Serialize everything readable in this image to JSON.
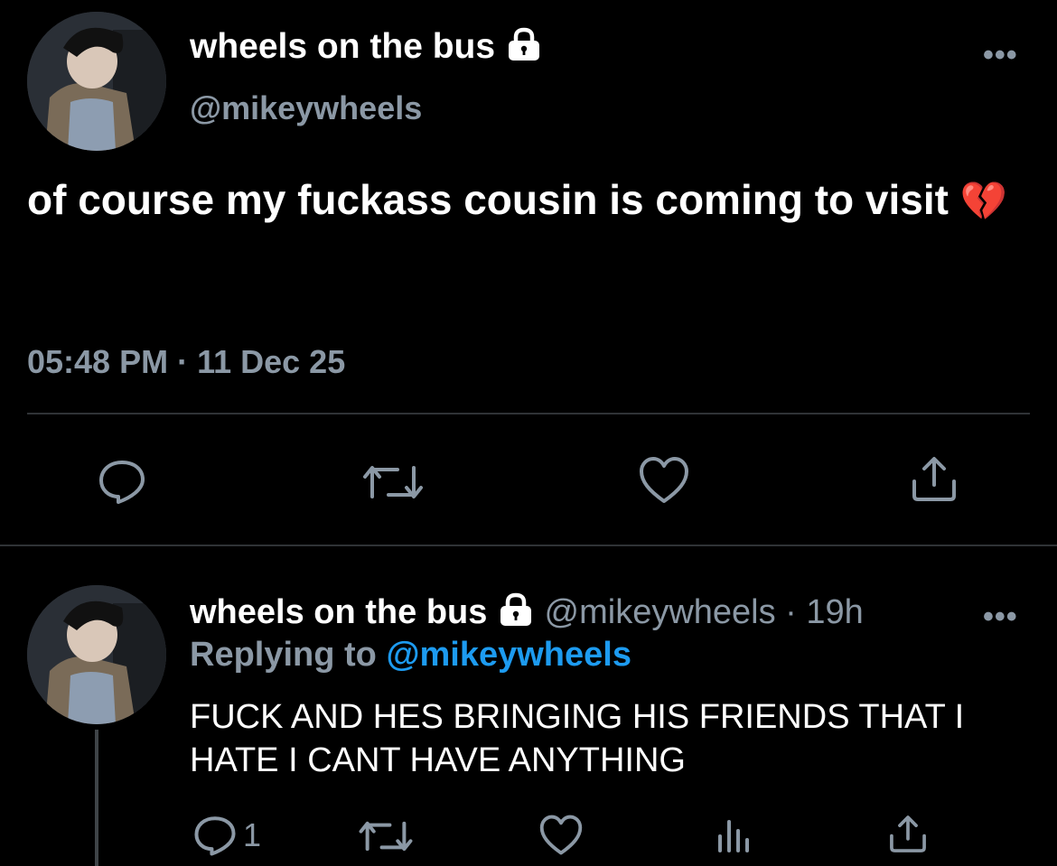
{
  "main_tweet": {
    "display_name": "wheels on the bus",
    "handle": "@mikeywheels",
    "text": "of course my fuckass cousin is coming to visit",
    "emoji": "💔",
    "timestamp": "05:48 PM · 11 Dec 25",
    "more_label": "•••"
  },
  "reply_tweet": {
    "display_name": "wheels on the bus",
    "handle": "@mikeywheels",
    "time_ago": "19h",
    "separator": "·",
    "replying_label": "Replying to",
    "replying_handle": "@mikeywheels",
    "text": "FUCK AND HES BRINGING HIS FRIENDS THAT I HATE I CANT HAVE ANYTHING",
    "reply_count": "1",
    "more_label": "•••"
  },
  "icons": {
    "reply": "reply-icon",
    "retweet": "retweet-icon",
    "like": "heart-icon",
    "share": "share-icon",
    "analytics": "analytics-icon",
    "lock": "lock-icon"
  },
  "colors": {
    "background": "#000000",
    "text": "#ffffff",
    "secondary": "#8b98a5",
    "link": "#1d9bf0",
    "divider": "#2f3336"
  }
}
